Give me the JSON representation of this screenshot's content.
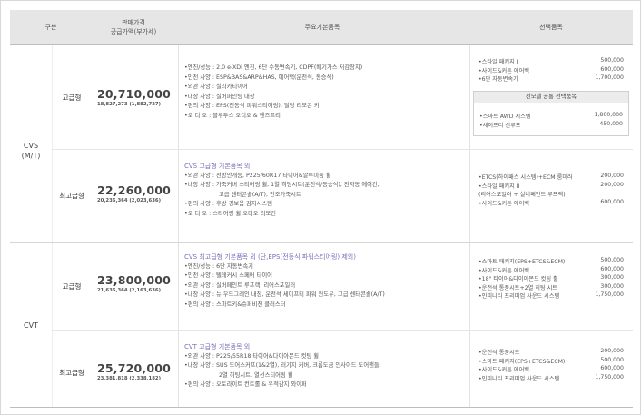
{
  "header": {
    "group": "구분",
    "price_line1": "판매가격",
    "price_line2": "공급가액(부가세)",
    "features": "주요기본품목",
    "options": "선택품목"
  },
  "groups": [
    {
      "label_line1": "CVS",
      "label_line2": "(M/T)"
    },
    {
      "label_line1": "CVT"
    }
  ],
  "rows": [
    {
      "trim": "고급형",
      "price": "20,710,000",
      "supply": "18,827,273 (1,882,727)",
      "features": [
        {
          "type": "item",
          "text": "엔진/성능 : 2.0 e-XDi 엔진, 6단 수동변속기, CDPF(배기가스 저감장치)"
        },
        {
          "type": "item",
          "text": "안전 사양 : ESP&BAS&ARP&HAS, 에어백(운전석, 동승석)"
        },
        {
          "type": "item",
          "text": "외관 사양 : 실리카티이어"
        },
        {
          "type": "item",
          "text": "내장 사양 : 실버퍼인팅 내장"
        },
        {
          "type": "item",
          "text": "편의 사양 : EPS(전동식 파워스티어링), 틸팅 리모콘 키"
        },
        {
          "type": "item",
          "text": "오 디 오 : 블루투스 오디오 & 핸즈프리"
        }
      ],
      "options": [
        {
          "name": "스타일 패키지 I",
          "price": "500,000"
        },
        {
          "name": "사이드&커튼 에어백",
          "price": "600,000"
        },
        {
          "name": "6단 자동변속기",
          "price": "1,700,000"
        }
      ],
      "sub_title": "전모델 공통 선택품목",
      "sub_options": [
        {
          "name": "스마트 AWD 시스템",
          "price": "1,800,000"
        },
        {
          "name": "세이프티 선루프",
          "price": "450,000"
        }
      ]
    },
    {
      "trim": "최고급형",
      "price": "22,260,000",
      "supply": "20,236,364 (2,023,636)",
      "features": [
        {
          "type": "title",
          "text": "CVS 고급형 기본품목 외"
        },
        {
          "type": "item",
          "text": "외관 사양 : 전방안개등, P225/60R17 타이어&알루미늄 휠"
        },
        {
          "type": "item",
          "text": "내장 사양 : 가죽커버 스티어링 휠, 1열 히팅시트(운전석/동승석), 전자동 에어컨,"
        },
        {
          "type": "cont",
          "text": "고급 센터콘솔(A/T), 인조가죽시트"
        },
        {
          "type": "item",
          "text": "편의 사양 : 후방 경보음 감지시스템"
        },
        {
          "type": "item",
          "text": "오 디 오 : 스티어링 휠 오디오 리모컨"
        }
      ],
      "options": [
        {
          "name": "ETCS(하이패스 시스템)+ECM 룸미러",
          "price": "200,000"
        },
        {
          "name": "스타일 패키지 II",
          "price": "200,000"
        },
        {
          "name": "(리어스포일러 + 실버페인트 루프랙)",
          "price": "",
          "plain": true
        },
        {
          "name": "사이드&커튼 에어백",
          "price": "600,000"
        }
      ]
    },
    {
      "trim": "고급형",
      "price": "23,800,000",
      "supply": "21,636,364 (2,163,636)",
      "features": [
        {
          "type": "title",
          "text": "CVS 최고급형 기본품목 외 (단,EPS(전동식 파워스티어링) 제외)"
        },
        {
          "type": "item",
          "text": "엔진/성능 : 6단 자동변속기"
        },
        {
          "type": "item",
          "text": "안전 사양 : 텔레커시 스페어 타이어"
        },
        {
          "type": "item",
          "text": "외관 사양 : 실버페인트 루프랙, 리어스포일러"
        },
        {
          "type": "item",
          "text": "내장 사양 : 뉴 우드그레인 내장, 운전석 세이프티 파워 윈도우, 고급 센터콘솔(A/T)"
        },
        {
          "type": "item",
          "text": "편의 사양 : 스마트키&슈퍼비전 클러스터"
        }
      ],
      "options": [
        {
          "name": "스마트 패키지(EPS+ETCS&ECM)",
          "price": "500,000"
        },
        {
          "name": "사이드&커튼 에어백",
          "price": "600,000"
        },
        {
          "name": "18\" 타이어&다이아몬드 컷팅 휠",
          "price": "300,000"
        },
        {
          "name": "운전석 통풍시트+2열 히팅 시트",
          "price": "300,000"
        },
        {
          "name": "인피니티 프리미엄 사운드 시스템",
          "price": "1,750,000"
        }
      ]
    },
    {
      "trim": "최고급형",
      "price": "25,720,000",
      "supply": "23,381,818 (2,338,182)",
      "features": [
        {
          "type": "title",
          "text": "CVT 고급형 기본품목 외"
        },
        {
          "type": "item",
          "text": "외관 사양 : P225/55R18 타이어&다이아몬드 컷팅 휠"
        },
        {
          "type": "item",
          "text": "내장 사양 : SUS 도어스커프(1&2열), 러기지 커버, 크롬도금 인사이드 도어핸들,"
        },
        {
          "type": "cont",
          "text": "2열 히팅시트, 열선스티어링 휠"
        },
        {
          "type": "item",
          "text": "편의 사양 : 오토라이트 컨트롤 & 우적감지 와이퍼"
        }
      ],
      "options": [
        {
          "name": "운전석 통풍시트",
          "price": "200,000"
        },
        {
          "name": "스마트 패키지(EPS+ETCS&ECM)",
          "price": "500,000"
        },
        {
          "name": "사이드&커튼 에어백",
          "price": "600,000"
        },
        {
          "name": "인피니티 프리미엄 사운드 시스템",
          "price": "1,750,000"
        }
      ]
    }
  ]
}
